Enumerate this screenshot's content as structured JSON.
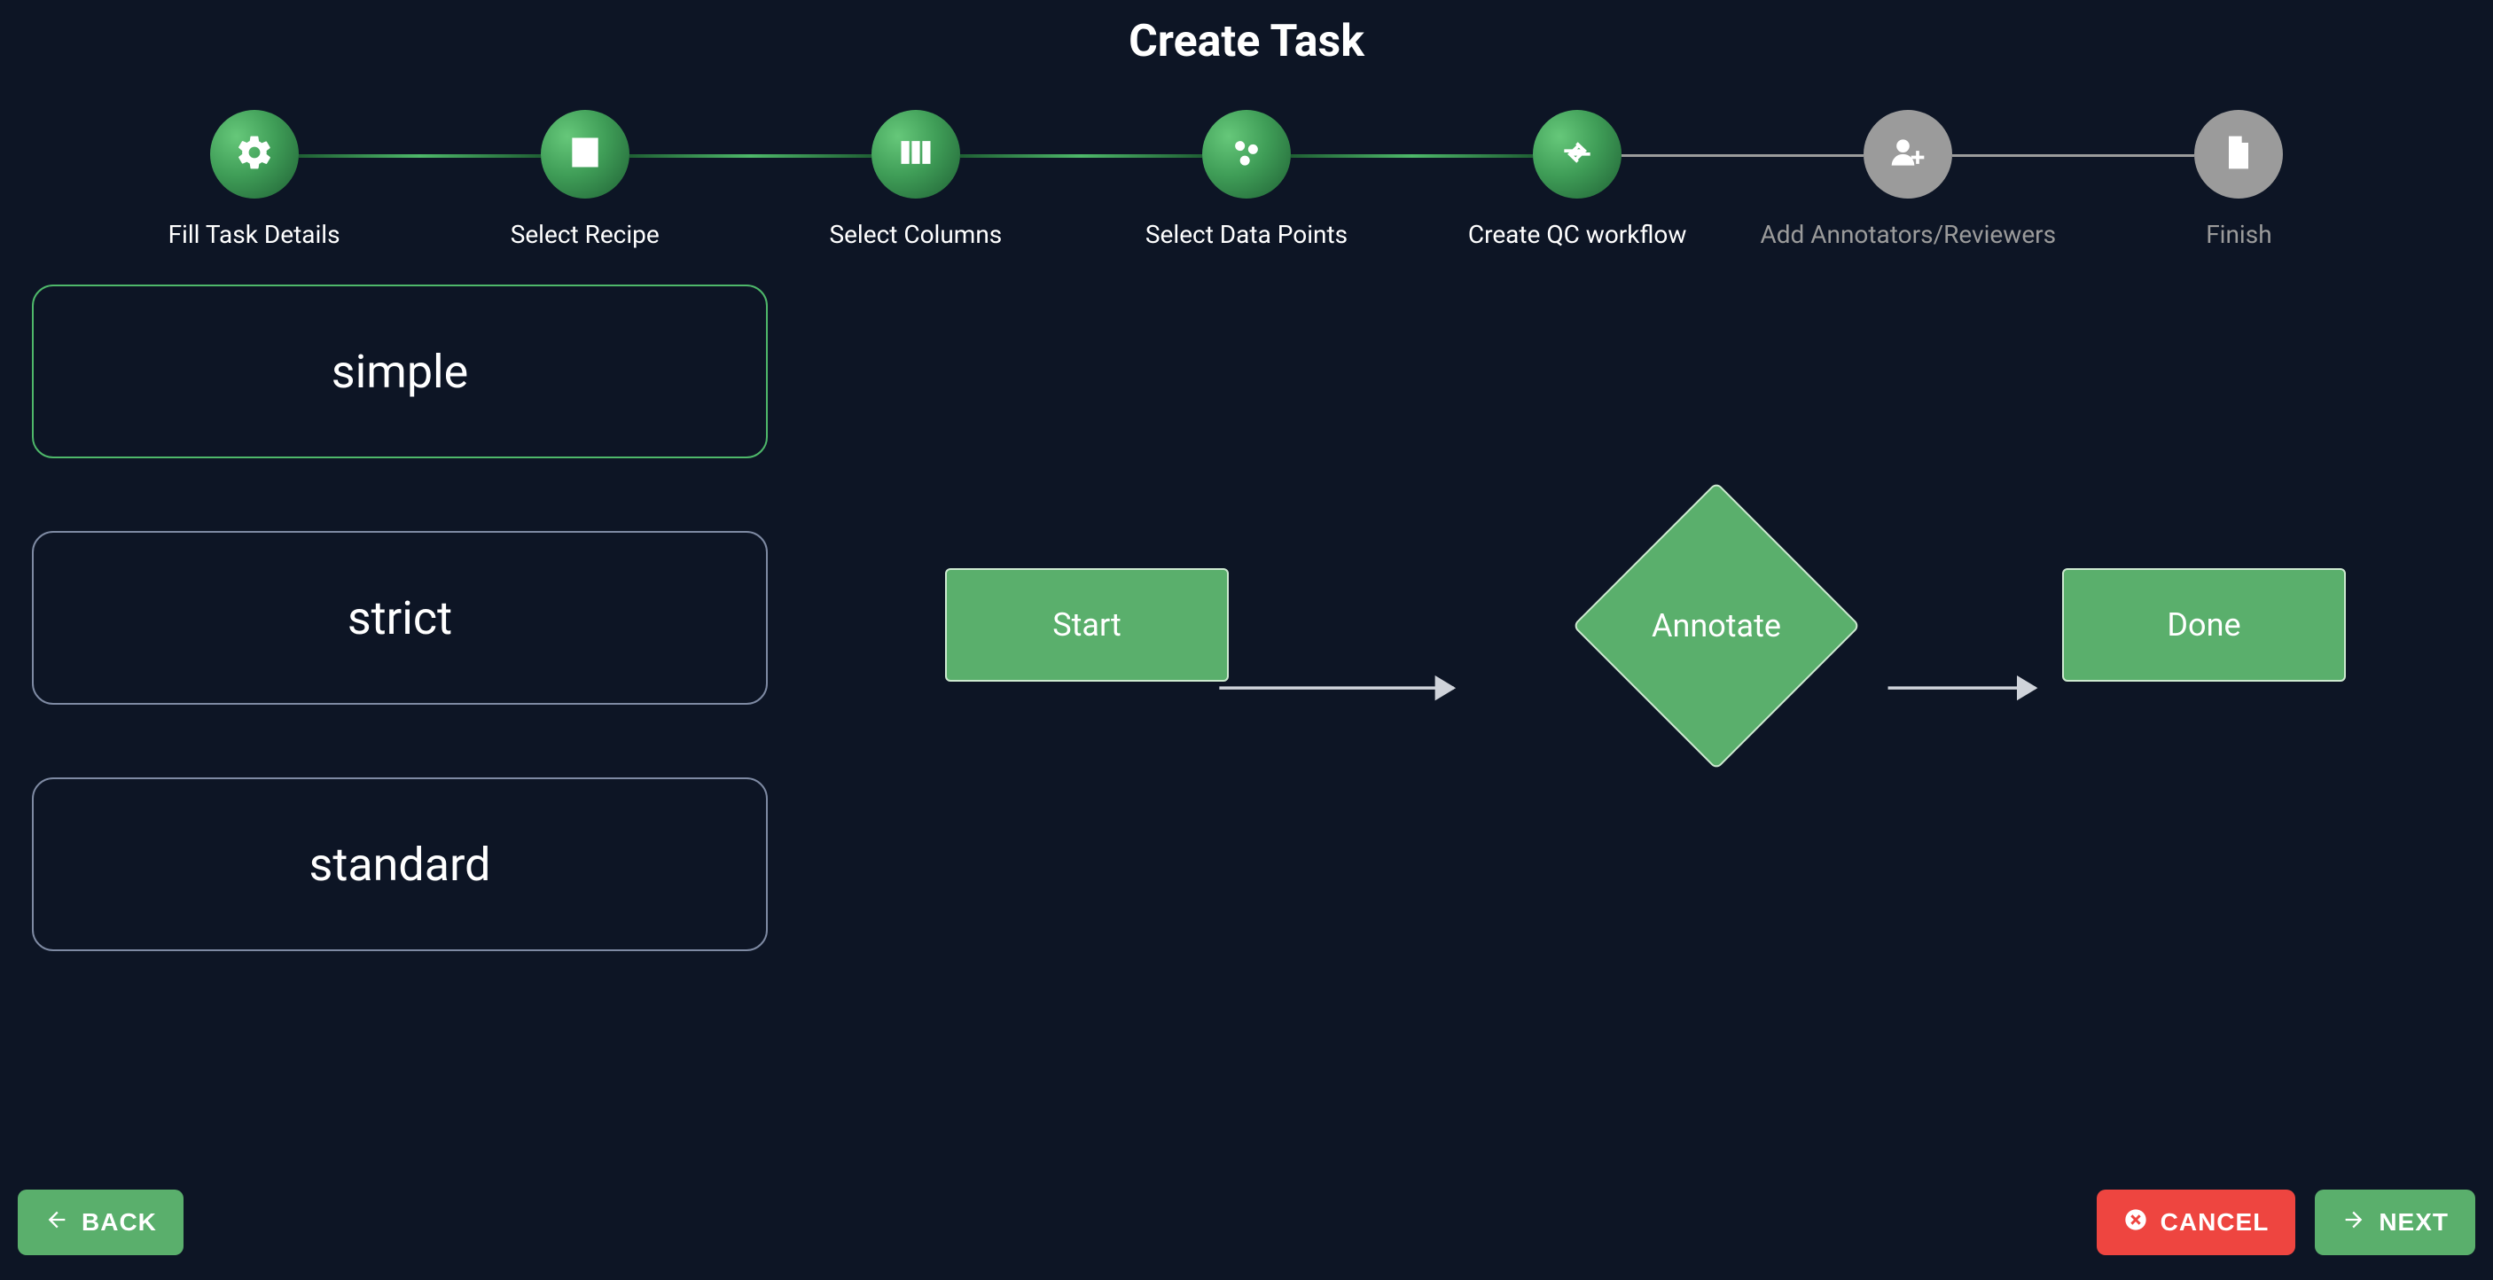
{
  "title": "Create Task",
  "stepper": {
    "active_index": 4,
    "steps": [
      {
        "label": "Fill Task Details",
        "status": "done",
        "icon": "gear-icon"
      },
      {
        "label": "Select Recipe",
        "status": "done",
        "icon": "list-icon"
      },
      {
        "label": "Select Columns",
        "status": "done",
        "icon": "columns-icon"
      },
      {
        "label": "Select Data Points",
        "status": "done",
        "icon": "scatter-icon"
      },
      {
        "label": "Create QC workflow",
        "status": "active",
        "icon": "arrows-icon"
      },
      {
        "label": "Add Annotators/Reviewers",
        "status": "pending",
        "icon": "people-plus-icon"
      },
      {
        "label": "Finish",
        "status": "pending",
        "icon": "document-icon"
      }
    ]
  },
  "qc_options": {
    "selected": "simple",
    "items": [
      {
        "id": "simple",
        "label": "simple"
      },
      {
        "id": "strict",
        "label": "strict"
      },
      {
        "id": "standard",
        "label": "standard"
      }
    ]
  },
  "flow": {
    "nodes": [
      {
        "id": "start",
        "label": "Start",
        "shape": "rect"
      },
      {
        "id": "annotate",
        "label": "Annotate",
        "shape": "diamond"
      },
      {
        "id": "done",
        "label": "Done",
        "shape": "rect"
      }
    ],
    "edges": [
      {
        "from": "start",
        "to": "annotate"
      },
      {
        "from": "annotate",
        "to": "done"
      }
    ]
  },
  "footer": {
    "back": "BACK",
    "cancel": "CANCEL",
    "next": "NEXT"
  },
  "colors": {
    "bg": "#0d1525",
    "accent_green": "#5aaf6c",
    "accent_red": "#ee4540",
    "muted": "#9b9b9b"
  }
}
